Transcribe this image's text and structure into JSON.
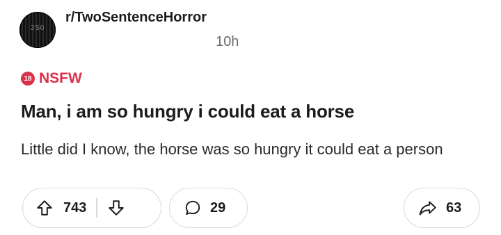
{
  "post": {
    "subreddit": "r/TwoSentenceHorror",
    "avatar_text": "2S0",
    "time": "10h",
    "nsfw_label": "NSFW",
    "nsfw_icon_text": "18",
    "title": "Man, i am so hungry i could eat a horse",
    "body": "Little did I know, the horse was so hungry it could eat a person"
  },
  "actions": {
    "upvotes": "743",
    "comments": "29",
    "shares": "63"
  },
  "icons": {
    "upvote": "upvote-arrow-icon",
    "downvote": "downvote-arrow-icon",
    "comment": "comment-bubble-icon",
    "share": "share-arrow-icon"
  },
  "colors": {
    "nsfw": "#d9324a",
    "text": "#1c1c1c",
    "muted": "#6b6b6b",
    "border": "#d9d9d9"
  }
}
